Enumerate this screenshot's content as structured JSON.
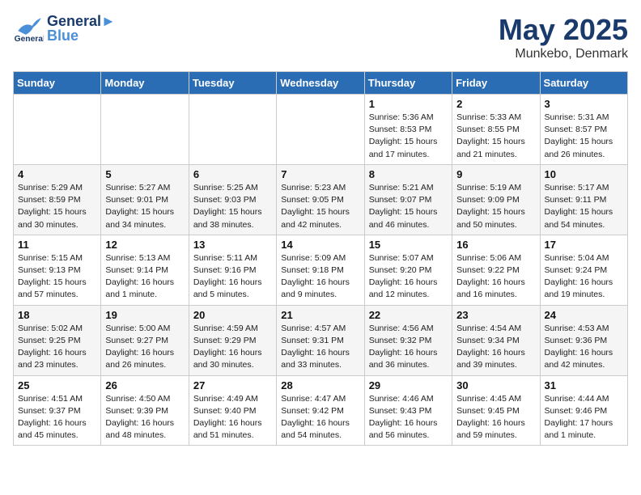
{
  "header": {
    "logo_line1": "General",
    "logo_line2": "Blue",
    "month": "May 2025",
    "location": "Munkebo, Denmark"
  },
  "weekdays": [
    "Sunday",
    "Monday",
    "Tuesday",
    "Wednesday",
    "Thursday",
    "Friday",
    "Saturday"
  ],
  "weeks": [
    [
      {
        "day": "",
        "sunrise": "",
        "sunset": "",
        "daylight": ""
      },
      {
        "day": "",
        "sunrise": "",
        "sunset": "",
        "daylight": ""
      },
      {
        "day": "",
        "sunrise": "",
        "sunset": "",
        "daylight": ""
      },
      {
        "day": "",
        "sunrise": "",
        "sunset": "",
        "daylight": ""
      },
      {
        "day": "1",
        "sunrise": "Sunrise: 5:36 AM",
        "sunset": "Sunset: 8:53 PM",
        "daylight": "Daylight: 15 hours and 17 minutes."
      },
      {
        "day": "2",
        "sunrise": "Sunrise: 5:33 AM",
        "sunset": "Sunset: 8:55 PM",
        "daylight": "Daylight: 15 hours and 21 minutes."
      },
      {
        "day": "3",
        "sunrise": "Sunrise: 5:31 AM",
        "sunset": "Sunset: 8:57 PM",
        "daylight": "Daylight: 15 hours and 26 minutes."
      }
    ],
    [
      {
        "day": "4",
        "sunrise": "Sunrise: 5:29 AM",
        "sunset": "Sunset: 8:59 PM",
        "daylight": "Daylight: 15 hours and 30 minutes."
      },
      {
        "day": "5",
        "sunrise": "Sunrise: 5:27 AM",
        "sunset": "Sunset: 9:01 PM",
        "daylight": "Daylight: 15 hours and 34 minutes."
      },
      {
        "day": "6",
        "sunrise": "Sunrise: 5:25 AM",
        "sunset": "Sunset: 9:03 PM",
        "daylight": "Daylight: 15 hours and 38 minutes."
      },
      {
        "day": "7",
        "sunrise": "Sunrise: 5:23 AM",
        "sunset": "Sunset: 9:05 PM",
        "daylight": "Daylight: 15 hours and 42 minutes."
      },
      {
        "day": "8",
        "sunrise": "Sunrise: 5:21 AM",
        "sunset": "Sunset: 9:07 PM",
        "daylight": "Daylight: 15 hours and 46 minutes."
      },
      {
        "day": "9",
        "sunrise": "Sunrise: 5:19 AM",
        "sunset": "Sunset: 9:09 PM",
        "daylight": "Daylight: 15 hours and 50 minutes."
      },
      {
        "day": "10",
        "sunrise": "Sunrise: 5:17 AM",
        "sunset": "Sunset: 9:11 PM",
        "daylight": "Daylight: 15 hours and 54 minutes."
      }
    ],
    [
      {
        "day": "11",
        "sunrise": "Sunrise: 5:15 AM",
        "sunset": "Sunset: 9:13 PM",
        "daylight": "Daylight: 15 hours and 57 minutes."
      },
      {
        "day": "12",
        "sunrise": "Sunrise: 5:13 AM",
        "sunset": "Sunset: 9:14 PM",
        "daylight": "Daylight: 16 hours and 1 minute."
      },
      {
        "day": "13",
        "sunrise": "Sunrise: 5:11 AM",
        "sunset": "Sunset: 9:16 PM",
        "daylight": "Daylight: 16 hours and 5 minutes."
      },
      {
        "day": "14",
        "sunrise": "Sunrise: 5:09 AM",
        "sunset": "Sunset: 9:18 PM",
        "daylight": "Daylight: 16 hours and 9 minutes."
      },
      {
        "day": "15",
        "sunrise": "Sunrise: 5:07 AM",
        "sunset": "Sunset: 9:20 PM",
        "daylight": "Daylight: 16 hours and 12 minutes."
      },
      {
        "day": "16",
        "sunrise": "Sunrise: 5:06 AM",
        "sunset": "Sunset: 9:22 PM",
        "daylight": "Daylight: 16 hours and 16 minutes."
      },
      {
        "day": "17",
        "sunrise": "Sunrise: 5:04 AM",
        "sunset": "Sunset: 9:24 PM",
        "daylight": "Daylight: 16 hours and 19 minutes."
      }
    ],
    [
      {
        "day": "18",
        "sunrise": "Sunrise: 5:02 AM",
        "sunset": "Sunset: 9:25 PM",
        "daylight": "Daylight: 16 hours and 23 minutes."
      },
      {
        "day": "19",
        "sunrise": "Sunrise: 5:00 AM",
        "sunset": "Sunset: 9:27 PM",
        "daylight": "Daylight: 16 hours and 26 minutes."
      },
      {
        "day": "20",
        "sunrise": "Sunrise: 4:59 AM",
        "sunset": "Sunset: 9:29 PM",
        "daylight": "Daylight: 16 hours and 30 minutes."
      },
      {
        "day": "21",
        "sunrise": "Sunrise: 4:57 AM",
        "sunset": "Sunset: 9:31 PM",
        "daylight": "Daylight: 16 hours and 33 minutes."
      },
      {
        "day": "22",
        "sunrise": "Sunrise: 4:56 AM",
        "sunset": "Sunset: 9:32 PM",
        "daylight": "Daylight: 16 hours and 36 minutes."
      },
      {
        "day": "23",
        "sunrise": "Sunrise: 4:54 AM",
        "sunset": "Sunset: 9:34 PM",
        "daylight": "Daylight: 16 hours and 39 minutes."
      },
      {
        "day": "24",
        "sunrise": "Sunrise: 4:53 AM",
        "sunset": "Sunset: 9:36 PM",
        "daylight": "Daylight: 16 hours and 42 minutes."
      }
    ],
    [
      {
        "day": "25",
        "sunrise": "Sunrise: 4:51 AM",
        "sunset": "Sunset: 9:37 PM",
        "daylight": "Daylight: 16 hours and 45 minutes."
      },
      {
        "day": "26",
        "sunrise": "Sunrise: 4:50 AM",
        "sunset": "Sunset: 9:39 PM",
        "daylight": "Daylight: 16 hours and 48 minutes."
      },
      {
        "day": "27",
        "sunrise": "Sunrise: 4:49 AM",
        "sunset": "Sunset: 9:40 PM",
        "daylight": "Daylight: 16 hours and 51 minutes."
      },
      {
        "day": "28",
        "sunrise": "Sunrise: 4:47 AM",
        "sunset": "Sunset: 9:42 PM",
        "daylight": "Daylight: 16 hours and 54 minutes."
      },
      {
        "day": "29",
        "sunrise": "Sunrise: 4:46 AM",
        "sunset": "Sunset: 9:43 PM",
        "daylight": "Daylight: 16 hours and 56 minutes."
      },
      {
        "day": "30",
        "sunrise": "Sunrise: 4:45 AM",
        "sunset": "Sunset: 9:45 PM",
        "daylight": "Daylight: 16 hours and 59 minutes."
      },
      {
        "day": "31",
        "sunrise": "Sunrise: 4:44 AM",
        "sunset": "Sunset: 9:46 PM",
        "daylight": "Daylight: 17 hours and 1 minute."
      }
    ]
  ]
}
